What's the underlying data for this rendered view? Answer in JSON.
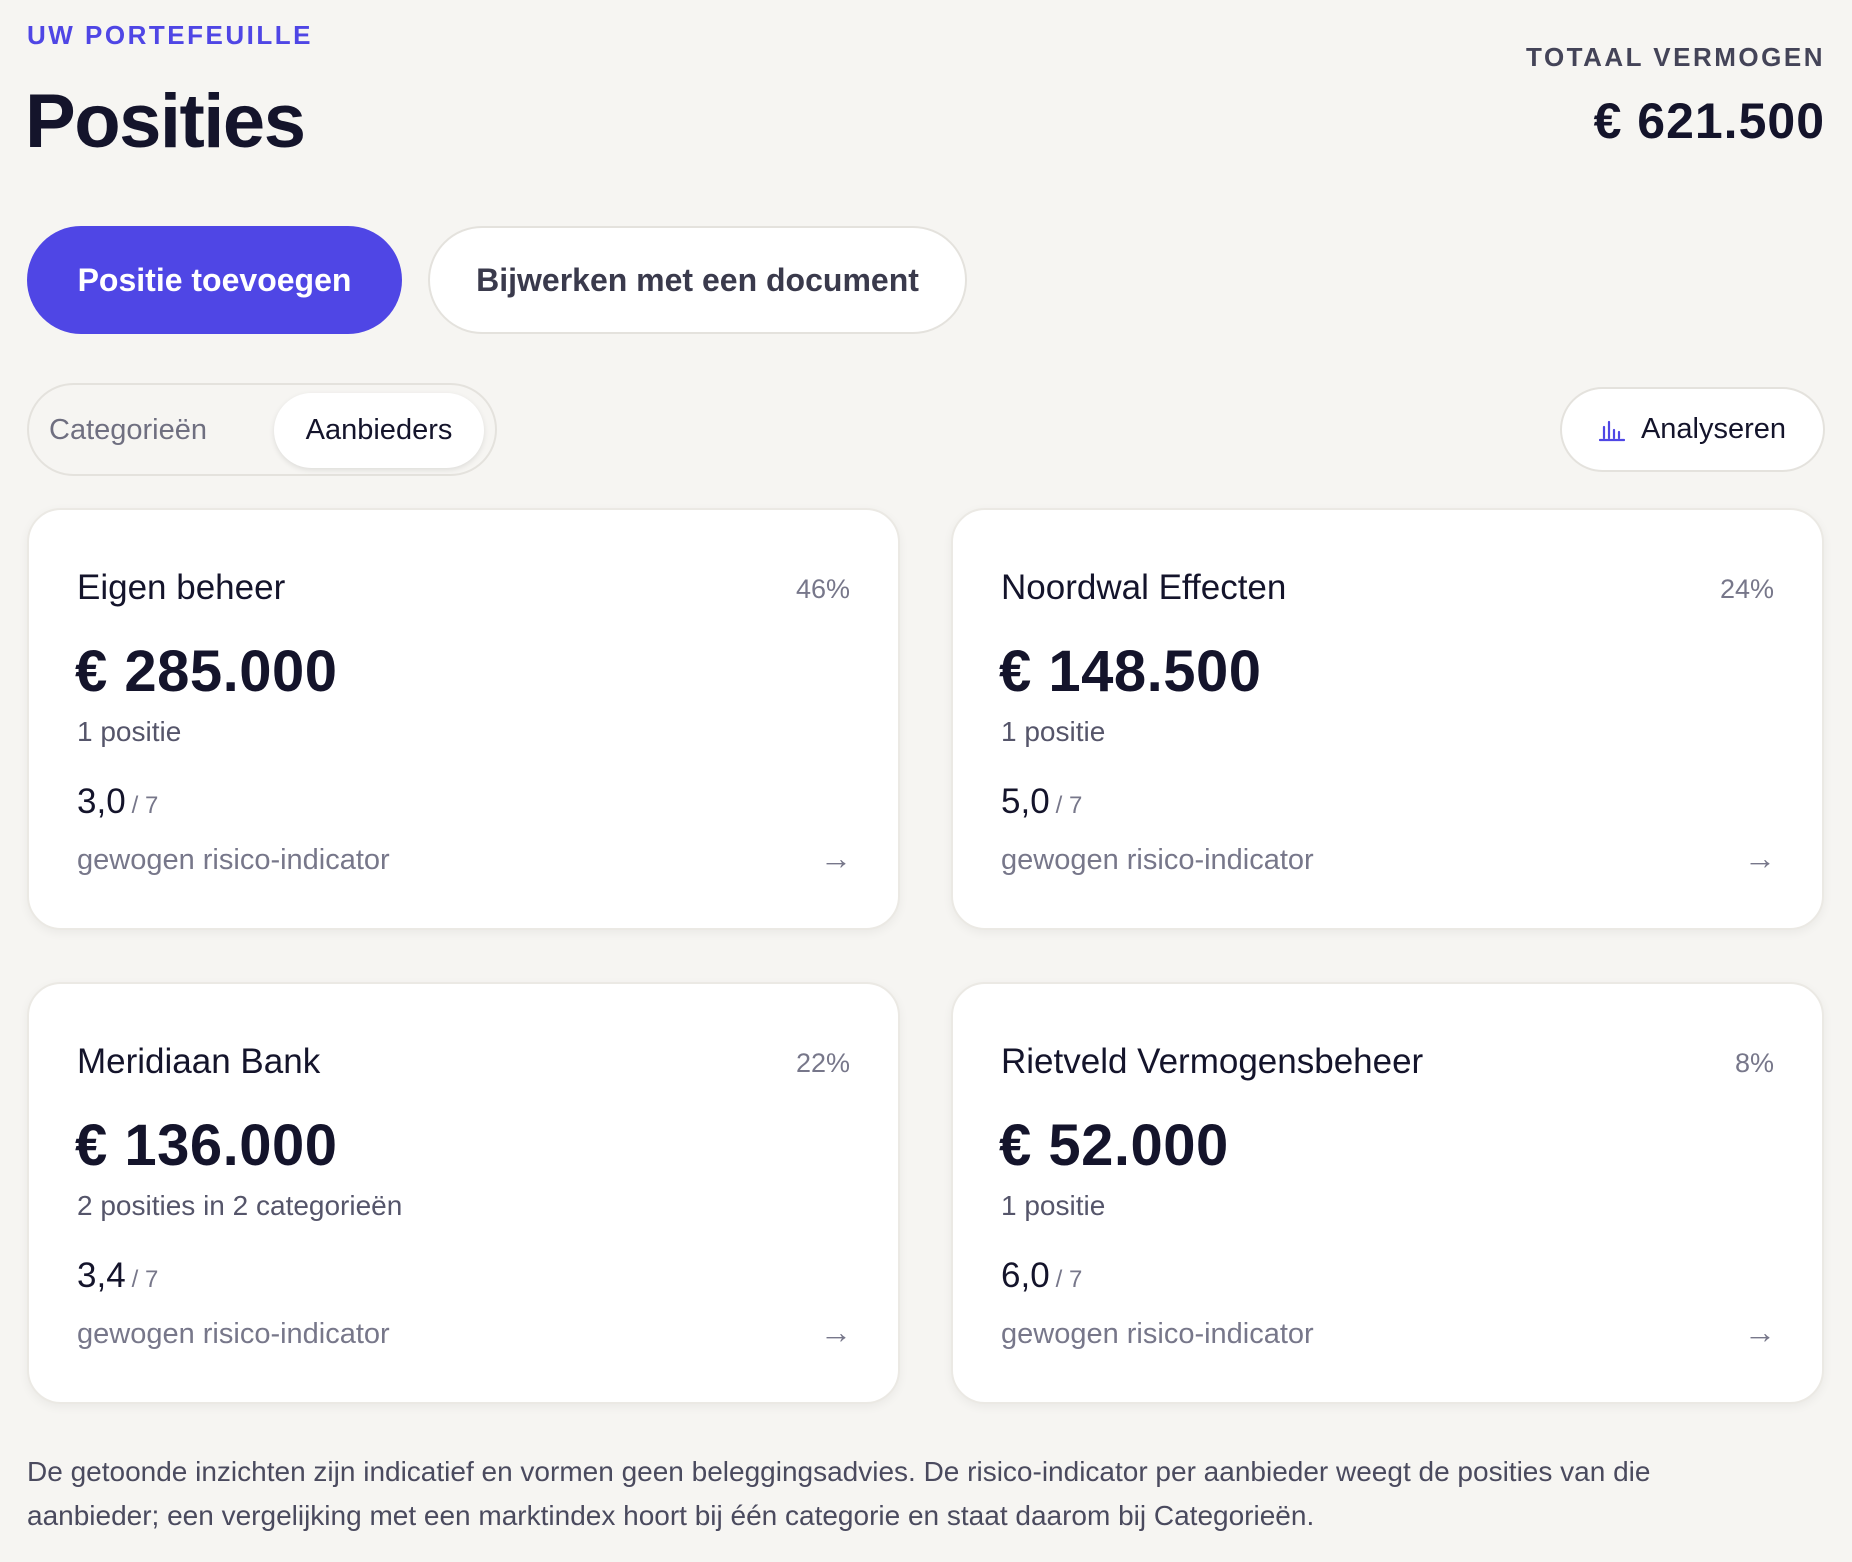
{
  "header": {
    "eyebrow": "UW PORTEFEUILLE",
    "title": "Posities",
    "total_label": "TOTAAL VERMOGEN",
    "total_value": "€ 621.500"
  },
  "actions": {
    "add_position": "Positie toevoegen",
    "update_with_document": "Bijwerken met een document"
  },
  "tabs": {
    "categories": "Categorieën",
    "providers": "Aanbieders",
    "active": "Aanbieders"
  },
  "analyze_button": {
    "label": "Analyseren",
    "icon": "bar-chart-icon"
  },
  "accent_color": "#4f46e5",
  "providers": [
    {
      "name": "Eigen beheer",
      "share": "46%",
      "value": "€ 285.000",
      "positions": "1 positie",
      "risk": "3,0",
      "risk_scale": "/ 7",
      "risk_label": "gewogen risico-indicator",
      "arrow": "→"
    },
    {
      "name": "Noordwal Effecten",
      "share": "24%",
      "value": "€ 148.500",
      "positions": "1 positie",
      "risk": "5,0",
      "risk_scale": "/ 7",
      "risk_label": "gewogen risico-indicator",
      "arrow": "→"
    },
    {
      "name": "Meridiaan Bank",
      "share": "22%",
      "value": "€ 136.000",
      "positions": "2 posities in 2 categorieën",
      "risk": "3,4",
      "risk_scale": "/ 7",
      "risk_label": "gewogen risico-indicator",
      "arrow": "→"
    },
    {
      "name": "Rietveld Vermogensbeheer",
      "share": "8%",
      "value": "€ 52.000",
      "positions": "1 positie",
      "risk": "6,0",
      "risk_scale": "/ 7",
      "risk_label": "gewogen risico-indicator",
      "arrow": "→"
    }
  ],
  "footnote": "De getoonde inzichten zijn indicatief en vormen geen beleggingsadvies. De risico-indicator per aanbieder weegt de posities van die aanbieder; een vergelijking met een marktindex hoort bij één categorie en staat daarom bij Categorieën."
}
